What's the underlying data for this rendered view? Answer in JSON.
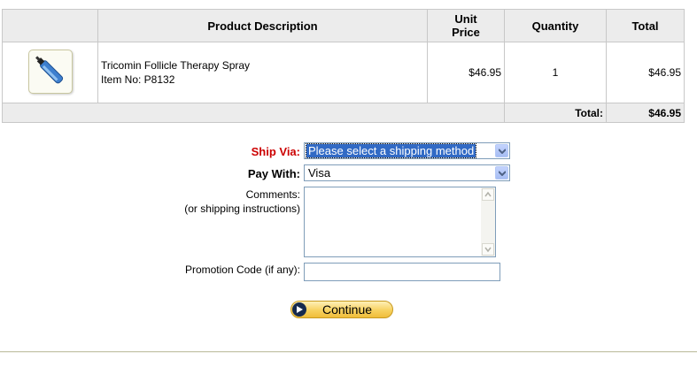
{
  "cart": {
    "headers": {
      "image": "",
      "description": "Product Description",
      "unit_price_1": "Unit",
      "unit_price_2": "Price",
      "quantity": "Quantity",
      "total": "Total"
    },
    "items": [
      {
        "name": "Tricomin Follicle Therapy Spray",
        "item_no": "Item No: P8132",
        "unit_price": "$46.95",
        "quantity": "1",
        "total": "$46.95",
        "image_icon": "spray-bottle-icon"
      }
    ],
    "footer": {
      "total_label": "Total:",
      "total_value": "$46.95"
    }
  },
  "form": {
    "ship_via": {
      "label": "Ship Via:",
      "value": "Please select a shipping method"
    },
    "pay_with": {
      "label": "Pay With:",
      "value": "Visa"
    },
    "comments": {
      "label": "Comments:",
      "sublabel": "(or shipping instructions)",
      "value": ""
    },
    "promo": {
      "label": "Promotion Code (if any):",
      "value": ""
    },
    "continue_label": "Continue"
  },
  "colors": {
    "required_label": "#cc0000",
    "selection": "#316ac5",
    "button": "#f7d160"
  }
}
